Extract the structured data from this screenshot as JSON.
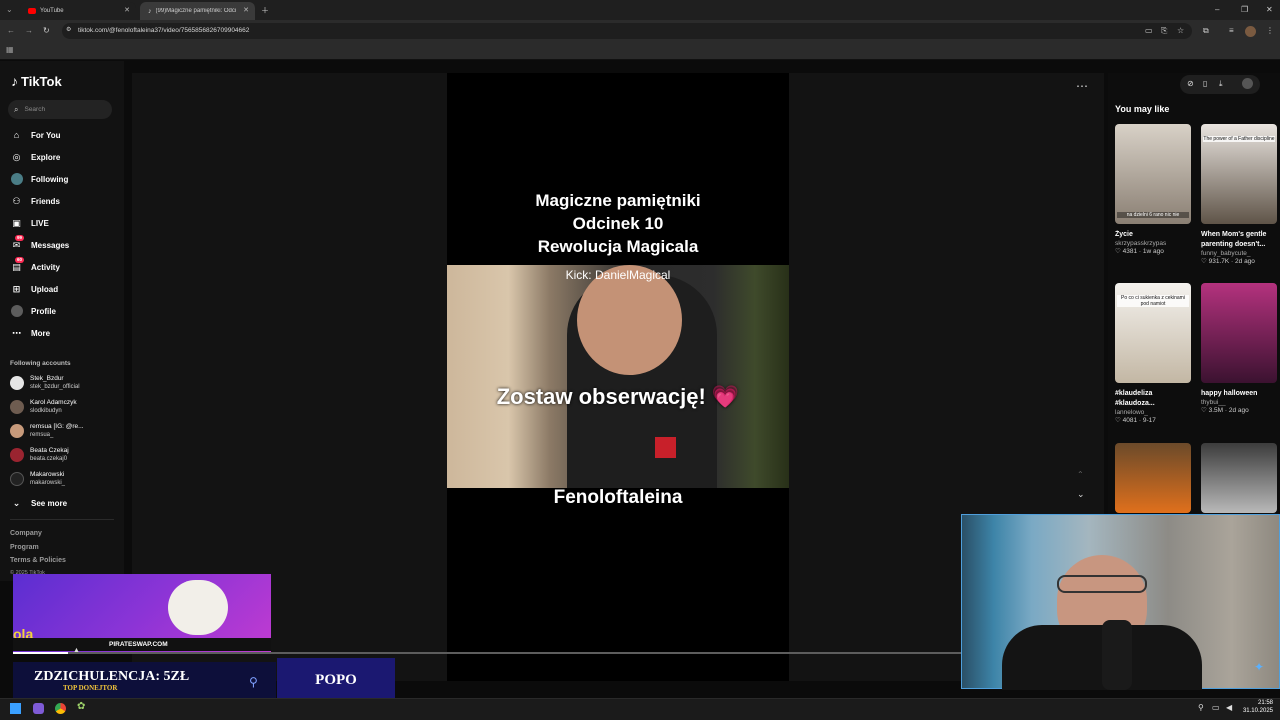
{
  "browser": {
    "tabs": [
      {
        "title": "YouTube"
      },
      {
        "title": "(99)Magiczne pamiętniki: Odci"
      }
    ],
    "url": "tiktok.com/@fenoloftaleina37/video/7565856826709904662"
  },
  "tiktok": {
    "logo": "TikTok",
    "search_placeholder": "Search",
    "nav": [
      {
        "label": "For You",
        "icon": "home-icon"
      },
      {
        "label": "Explore",
        "icon": "compass-icon"
      },
      {
        "label": "Following",
        "icon": "following-avatar-icon"
      },
      {
        "label": "Friends",
        "icon": "friends-icon"
      },
      {
        "label": "LIVE",
        "icon": "live-icon"
      },
      {
        "label": "Messages",
        "icon": "message-icon",
        "badge": "99"
      },
      {
        "label": "Activity",
        "icon": "activity-icon",
        "badge": "60"
      },
      {
        "label": "Upload",
        "icon": "plus-square-icon"
      },
      {
        "label": "Profile",
        "icon": "profile-avatar-icon"
      },
      {
        "label": "More",
        "icon": "dots-icon"
      }
    ],
    "following_header": "Following accounts",
    "following": [
      {
        "name": "Stek_Bzdur",
        "handle": "stek_bzdur_official"
      },
      {
        "name": "Karol Adamczyk",
        "handle": "slodkibudyn"
      },
      {
        "name": "remsua [IG: @re...",
        "handle": "remsua_"
      },
      {
        "name": "Beata Czekaj",
        "handle": "beata.czekaj0"
      },
      {
        "name": "Makarowski",
        "handle": "makarowski_"
      }
    ],
    "see_more": "See more",
    "footer": [
      "Company",
      "Program",
      "Terms & Policies",
      "© 2025 TikTok"
    ],
    "video": {
      "title_lines": [
        "Magiczne pamiętniki",
        "Odcinek 10",
        "Rewolucja Magicala"
      ],
      "kick": "Kick: DanielMagical",
      "overlay": "Zostaw obserwację! 💗",
      "author": "Fenoloftaleina"
    },
    "you_may_like": "You may like",
    "recommended": [
      {
        "title": "Życie",
        "user": "skrzypasskrzypas",
        "likes": "4381",
        "age": "1w ago",
        "thumb_text": "na dzielni 6 rano nic nie",
        "color_a": "#d8d1c7",
        "color_b": "#8a7f73"
      },
      {
        "title": "When Mom's gentle parenting doesn't...",
        "user": "funny_babycute_",
        "likes": "931.7K",
        "age": "2d ago",
        "thumb_text": "The power of a Father discipline",
        "color_a": "#e9e4df",
        "color_b": "#5f5448"
      },
      {
        "title": "#klaudeliza #klaudoza...",
        "user": "lannelowo_",
        "likes": "4081",
        "age": "9-17",
        "thumb_text": "Po co ci sukienka z cekinami pod namiot",
        "color_a": "#f4f2ee",
        "color_b": "#c3b7a4"
      },
      {
        "title": "happy halloween",
        "user": "thybui__",
        "likes": "3.5M",
        "age": "2d ago",
        "thumb_text": "",
        "color_a": "#b4327e",
        "color_b": "#3b1230"
      },
      {
        "title": "",
        "user": "",
        "likes": "",
        "age": "",
        "thumb_text": "",
        "color_a": "#6b4a2a",
        "color_b": "#e0701c"
      },
      {
        "title": "",
        "user": "",
        "likes": "",
        "age": "",
        "thumb_text": "",
        "color_a": "#3c3c3c",
        "color_b": "#b9b9b9"
      }
    ]
  },
  "stream": {
    "promo_domain": "PIRATESWAP.COM",
    "donation": "ZDZICHULENCJA: 5ZŁ",
    "donation_sub": "TOP DONEJTOR",
    "popo": "POPO"
  },
  "taskbar": {
    "time": "21:58",
    "date": "31.10.2025"
  }
}
